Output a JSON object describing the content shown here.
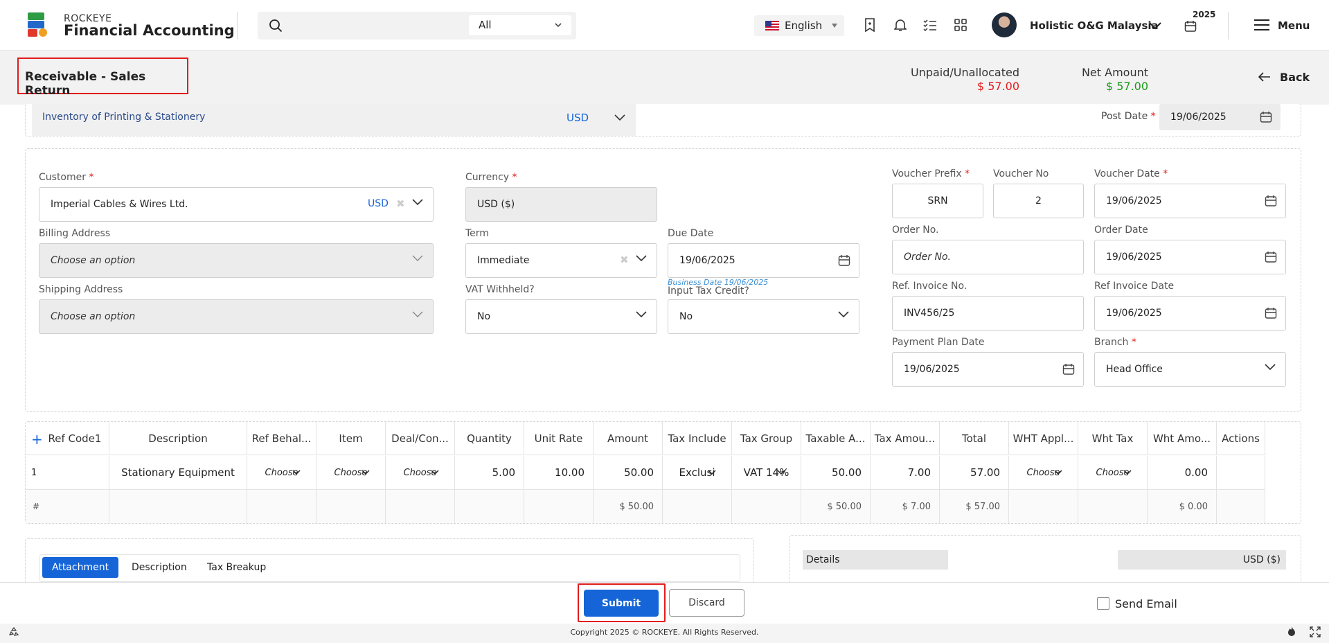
{
  "app": {
    "brand_top": "ROCKEYE",
    "brand_main": "Financial Accounting"
  },
  "topbar": {
    "search_scope": "All",
    "language": "English",
    "user_name": "Holistic O&G Malaysia",
    "year": "2025",
    "menu_label": "Menu"
  },
  "header": {
    "title": "Receivable - Sales Return",
    "unpaid_label": "Unpaid/Unallocated",
    "unpaid_value": "$ 57.00",
    "net_label": "Net Amount",
    "net_value": "$ 57.00",
    "back_label": "Back",
    "accent_red": "#e31b1b",
    "accent_green": "#1a9b1a"
  },
  "top_strip": {
    "account": "Inventory of Printing & Stationery",
    "currency": "USD",
    "post_date_label": "Post Date",
    "post_date": "19/06/2025"
  },
  "form": {
    "customer_label": "Customer",
    "customer_value": "Imperial Cables & Wires Ltd.",
    "customer_currency": "USD",
    "billing_label": "Billing Address",
    "billing_placeholder": "Choose an option",
    "shipping_label": "Shipping Address",
    "shipping_placeholder": "Choose an option",
    "currency_label": "Currency",
    "currency_value": "USD ($)",
    "term_label": "Term",
    "term_value": "Immediate",
    "due_date_label": "Due Date",
    "due_date_value": "19/06/2025",
    "business_date_note": "Business Date 19/06/2025",
    "vat_label": "VAT Withheld?",
    "vat_value": "No",
    "input_tax_label": "Input Tax Credit?",
    "input_tax_value": "No",
    "voucher_prefix_label": "Voucher Prefix",
    "voucher_prefix_value": "SRN",
    "voucher_no_label": "Voucher No",
    "voucher_no_value": "2",
    "voucher_date_label": "Voucher Date",
    "voucher_date_value": "19/06/2025",
    "order_no_label": "Order No.",
    "order_no_placeholder": "Order No.",
    "order_date_label": "Order Date",
    "order_date_value": "19/06/2025",
    "ref_invoice_label": "Ref. Invoice No.",
    "ref_invoice_value": "INV456/25",
    "ref_invoice_date_label": "Ref Invoice Date",
    "ref_invoice_date_value": "19/06/2025",
    "payment_plan_label": "Payment Plan Date",
    "payment_plan_value": "19/06/2025",
    "branch_label": "Branch",
    "branch_value": "Head Office"
  },
  "grid": {
    "add_symbol": "+",
    "columns": [
      "Ref Code1",
      "Description",
      "Ref Behal...",
      "Item",
      "Deal/Con...",
      "Quantity",
      "Unit Rate",
      "Amount",
      "Tax Include",
      "Tax Group",
      "Taxable A...",
      "Tax Amou...",
      "Total",
      "WHT Appl...",
      "Wht Tax",
      "Wht Amo...",
      "Actions"
    ],
    "row": {
      "index": "1",
      "ref_code": "",
      "description": "Stationary Equipment",
      "ref_behalf": "Choose",
      "item": "Choose",
      "deal": "Choose",
      "quantity": "5.00",
      "unit_rate": "10.00",
      "amount": "50.00",
      "tax_include": "Exclusi",
      "tax_group": "VAT 14%",
      "taxable": "50.00",
      "tax_amount": "7.00",
      "total": "57.00",
      "wht_appl": "Choose",
      "wht_tax": "Choose",
      "wht_amount": "0.00"
    },
    "footer": {
      "hash": "#",
      "amount": "$ 50.00",
      "taxable": "$ 50.00",
      "tax_amount": "$ 7.00",
      "total": "$ 57.00",
      "wht_amount": "$ 0.00"
    }
  },
  "bottom": {
    "tabs": [
      "Attachment",
      "Description",
      "Tax Breakup"
    ],
    "details_label": "Details",
    "details_currency": "USD ($)",
    "submit_label": "Submit",
    "discard_label": "Discard",
    "send_email_label": "Send Email",
    "copyright": "Copyright 2025 © ROCKEYE. All Rights Reserved."
  }
}
